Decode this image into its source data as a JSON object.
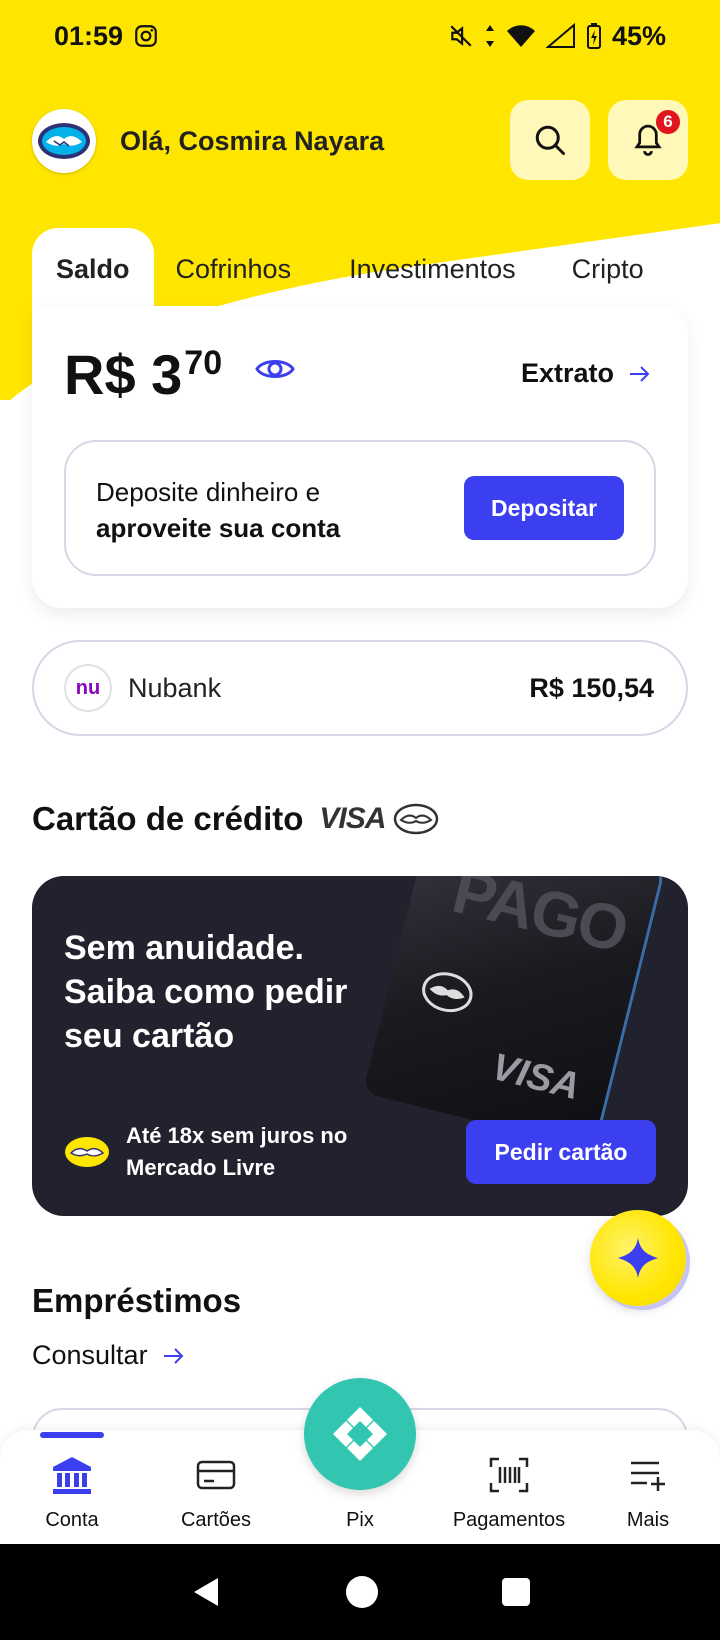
{
  "status_bar": {
    "time": "01:59",
    "battery": "45%"
  },
  "header": {
    "greeting": "Olá, Cosmira Nayara",
    "notifications_count": "6"
  },
  "tabs": [
    {
      "label": "Saldo",
      "active": true
    },
    {
      "label": "Cofrinhos",
      "active": false
    },
    {
      "label": "Investimentos",
      "active": false
    },
    {
      "label": "Cripto",
      "active": false
    }
  ],
  "balance": {
    "currency_int": "R$ 3",
    "cents": "70",
    "extrato_label": "Extrato"
  },
  "deposit": {
    "text_line1": "Deposite dinheiro e",
    "text_line2": "aproveite sua conta",
    "button_label": "Depositar"
  },
  "linked_account": {
    "logo": "nu",
    "name": "Nubank",
    "value": "R$ 150,54"
  },
  "credit_card": {
    "title": "Cartão de crédito",
    "brand": "VISA",
    "headline": "Sem anuidade. Saiba como pedir seu cartão",
    "card_print": "PAGO",
    "card_brand": "VISA",
    "footnote_line1": "Até 18x sem juros no",
    "footnote_line2": "Mercado Livre",
    "button_label": "Pedir cartão"
  },
  "loans": {
    "title": "Empréstimos",
    "link_label": "Consultar"
  },
  "bottom_nav": [
    {
      "label": "Conta",
      "icon": "bank-icon",
      "active": true
    },
    {
      "label": "Cartões",
      "icon": "card-icon",
      "active": false
    },
    {
      "label": "Pix",
      "icon": "pix-icon",
      "active": false
    },
    {
      "label": "Pagamentos",
      "icon": "barcode-icon",
      "active": false
    },
    {
      "label": "Mais",
      "icon": "more-icon",
      "active": false
    }
  ],
  "colors": {
    "brand_yellow": "#ffe600",
    "primary_blue": "#3c3ff0",
    "pix_teal": "#32c5b0",
    "banner_dark": "#22222e"
  }
}
